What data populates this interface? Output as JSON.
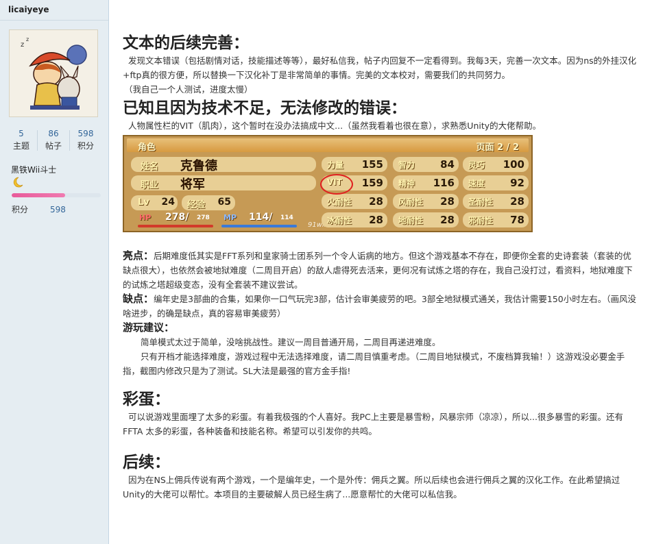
{
  "sidebar": {
    "username": "licaiyeye",
    "stats": [
      {
        "value": "5",
        "label": "主题"
      },
      {
        "value": "86",
        "label": "帖子"
      },
      {
        "value": "598",
        "label": "积分"
      }
    ],
    "rank": "黑铁Wii斗士",
    "points_label": "积分",
    "points_value": "598",
    "rank_progress": 0.6
  },
  "sections": {
    "s1_title": "文本的后续完善：",
    "s1_p1": "发现文本错误（包括剧情对话，技能描述等等），最好私信我，帖子内回复不一定看得到。我每3天，完善一次文本。因为ns的外挂汉化+ftp真的很方便，所以替换一下汉化补丁是非常简单的事情。完美的文本校对，需要我们的共同努力。",
    "s1_p2": "（我自己一个人测试，进度太慢）",
    "s2_title": "已知且因为技术不足，无法修改的错误：",
    "s2_p1": "人物属性栏的VIT（肌肉），这个暂时在没办法搞成中文...（虽然我看着也很在意），求熟悉Unity的大佬帮助。",
    "hl_label": "亮点：",
    "hl_text": "后期难度低其实是FFT系列和皇家骑士团系列一个令人诟病的地方。但这个游戏基本不存在，即便你全套的史诗套装（套装的优缺点很大），也依然会被地狱难度（二周目开启）的敌人虐得死去活来，更何况有试炼之塔的存在，我自己没打过，看资料，地狱难度下的试炼之塔超级变态，没有全套装不建议尝试。",
    "dp_label": "缺点：",
    "dp_text": "编年史是3部曲的合集，如果你一口气玩完3部，估计会审美疲劳的吧。3部全地狱模式通关，我估计需要150小时左右。（画风没啥进步，的确是缺点，真的容易审美疲劳）",
    "adv_label": "游玩建议：",
    "adv_p1": "简单模式太过于简单，没啥挑战性。建议一周目普通开局，二周目再递进难度。",
    "adv_p2": "只有开档才能选择难度，游戏过程中无法选择难度，请二周目慎重考虑。（二周目地狱模式，不废档算我输！）这游戏没必要金手指，截图内修改只是为了测试。SL大法是最强的官方金手指!",
    "egg_title": "彩蛋：",
    "egg_p": "可以说游戏里面埋了太多的彩蛋。有着我极强的个人喜好。我PC上主要是暴雪粉，风暴宗师（凉凉），所以...很多暴雪的彩蛋。还有FFTA 太多的彩蛋，各种装备和技能名称。希望可以引发你的共鸣。",
    "next_title": "后续：",
    "next_p": "因为在NS上佣兵传说有两个游戏，一个是编年史，一个是外传：佣兵之翼。所以后续也会进行佣兵之翼的汉化工作。在此希望搞过Unity的大佬可以帮忙。本项目的主要破解人员已经生病了...愿意帮忙的大佬可以私信我。"
  },
  "game": {
    "header_left": "角色",
    "header_right": "页面 2 / 2",
    "name_label": "姓名",
    "name_value": "克鲁德",
    "job_label": "职业",
    "job_value": "将军",
    "lv_label": "Lv",
    "lv_value": "24",
    "exp_label": "经验",
    "exp_value": "65",
    "hp_label": "HP",
    "hp_value": "278/",
    "hp_max": "278",
    "mp_label": "MP",
    "mp_value": "114/",
    "mp_max": "114",
    "watermark": "91wii.com",
    "attrs": [
      {
        "label": "力量",
        "value": "155"
      },
      {
        "label": "智力",
        "value": "84"
      },
      {
        "label": "灵巧",
        "value": "100"
      },
      {
        "label": "VIT",
        "value": "159"
      },
      {
        "label": "精神",
        "value": "116"
      },
      {
        "label": "速度",
        "value": "92"
      },
      {
        "label": "火耐性",
        "value": "28"
      },
      {
        "label": "风耐性",
        "value": "28"
      },
      {
        "label": "圣耐性",
        "value": "28"
      },
      {
        "label": "冰耐性",
        "value": "28"
      },
      {
        "label": "地耐性",
        "value": "28"
      },
      {
        "label": "邪耐性",
        "value": "78"
      }
    ]
  },
  "colors": {
    "accent": "#336699",
    "highlight_circle": "#e02020",
    "progress": "#e85b9a"
  }
}
